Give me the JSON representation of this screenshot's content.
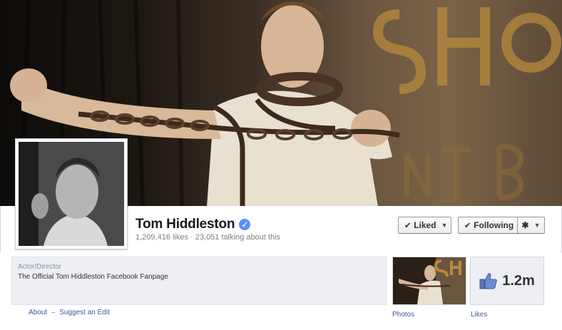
{
  "page": {
    "name": "Tom Hiddleston",
    "verified": true,
    "stats": "1,209,416 likes · 23,051 talking about this"
  },
  "actions": {
    "liked_label": "Liked",
    "following_label": "Following",
    "settings_icon": "gear-icon"
  },
  "about": {
    "category": "Actor/Director",
    "description": "The Official Tom Hiddleston Facebook Fanpage",
    "about_link": "About",
    "separator": "–",
    "suggest_edit_link": "Suggest an Edit"
  },
  "apps": {
    "photos_label": "Photos",
    "likes_label": "Likes",
    "likes_count": "1.2m",
    "likes_icon": "thumbs-up-icon"
  },
  "colors": {
    "link": "#3b5998",
    "verified_badge": "#5890ff",
    "info_bg": "#edeff4"
  }
}
